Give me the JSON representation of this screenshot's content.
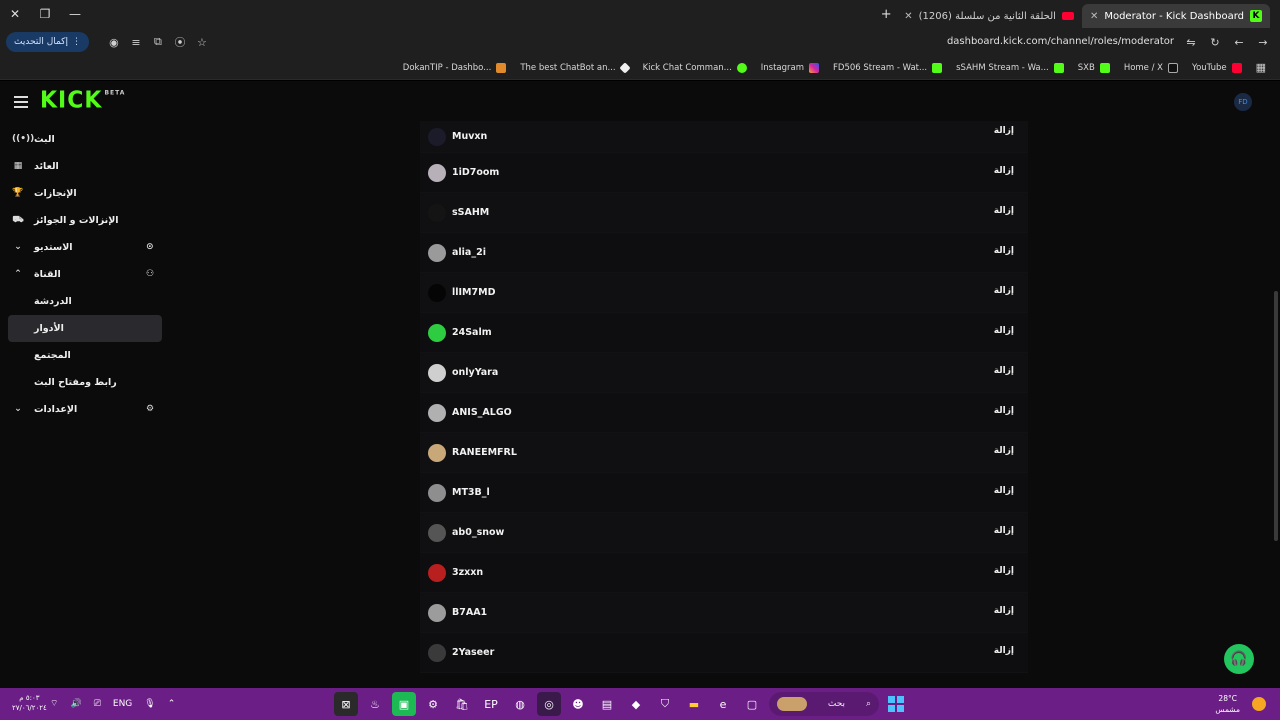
{
  "browser": {
    "tabs": [
      {
        "label": "Moderator - Kick Dashboard",
        "active": true
      },
      {
        "label": "(1206) الحلقة الثانية من سلسلة",
        "active": false
      }
    ],
    "update_button": "إكمال التحديث",
    "url": "dashboard.kick.com/channel/roles/moderator",
    "bookmarks": [
      {
        "label": "DokanTIP - Dashbo...",
        "icon": "orange"
      },
      {
        "label": "The best ChatBot an...",
        "icon": "white"
      },
      {
        "label": "Kick Chat Comman...",
        "icon": "green-dot"
      },
      {
        "label": "Instagram",
        "icon": "insta"
      },
      {
        "label": "FD506 Stream - Wat...",
        "icon": "kick"
      },
      {
        "label": "sSAHM Stream - Wa...",
        "icon": "kick"
      },
      {
        "label": "SXB",
        "icon": "kick"
      },
      {
        "label": "Home / X",
        "icon": "xx"
      },
      {
        "label": "YouTube",
        "icon": "yt"
      }
    ]
  },
  "kick": {
    "logo": "KICK",
    "logo_tag": "BETA",
    "sidebar": [
      {
        "label": "البث",
        "lead": "((•))",
        "trail": ""
      },
      {
        "label": "العائد",
        "lead": "▦",
        "trail": ""
      },
      {
        "label": "الإنجازات",
        "lead": "🏆",
        "trail": ""
      },
      {
        "label": "الإنزالات و الجوائز",
        "lead": "⛟",
        "trail": ""
      },
      {
        "label": "الاستديو",
        "lead": "⌄",
        "trail": "⊙"
      },
      {
        "label": "القناة",
        "lead": "⌃",
        "trail": "⚇"
      },
      {
        "label": "الدردشة",
        "lead": "",
        "trail": ""
      },
      {
        "label": "الأدوار",
        "lead": "",
        "trail": ""
      },
      {
        "label": "المجتمع",
        "lead": "",
        "trail": ""
      },
      {
        "label": "رابط ومفتاح البث",
        "lead": "",
        "trail": ""
      },
      {
        "label": "الإعدادات",
        "lead": "⌄",
        "trail": "⚙"
      }
    ],
    "remove_label": "إزالة",
    "moderators": [
      {
        "name": "Muvxn",
        "avatar_color": "#1b1b2a"
      },
      {
        "name": "1iD7oom",
        "avatar_color": "#b8b0b8"
      },
      {
        "name": "sSAHM",
        "avatar_color": "#141414"
      },
      {
        "name": "alia_2i",
        "avatar_color": "#9a9a9a"
      },
      {
        "name": "llIM7MD",
        "avatar_color": "#050505"
      },
      {
        "name": "24Salm",
        "avatar_color": "#2ecc40"
      },
      {
        "name": "onlyYara",
        "avatar_color": "#cfcfcf"
      },
      {
        "name": "ANIS_ALGO",
        "avatar_color": "#b0b0b0"
      },
      {
        "name": "RANEEMFRL",
        "avatar_color": "#c8a878"
      },
      {
        "name": "MT3B_l",
        "avatar_color": "#8e8e8e"
      },
      {
        "name": "ab0_snow",
        "avatar_color": "#555555"
      },
      {
        "name": "3zxxn",
        "avatar_color": "#b81f1f"
      },
      {
        "name": "B7AA1",
        "avatar_color": "#9c9c9c"
      },
      {
        "name": "2Yaseer",
        "avatar_color": "#3a3a3a"
      }
    ],
    "help_icon": "headset-icon"
  },
  "taskbar": {
    "time": "٥:٠٣ م",
    "date": "٢٧/٠٦/٢٠٢٤",
    "lang": "ENG",
    "search_label": "بحث",
    "weather_temp": "28°C",
    "weather_desc": "مشمس"
  }
}
